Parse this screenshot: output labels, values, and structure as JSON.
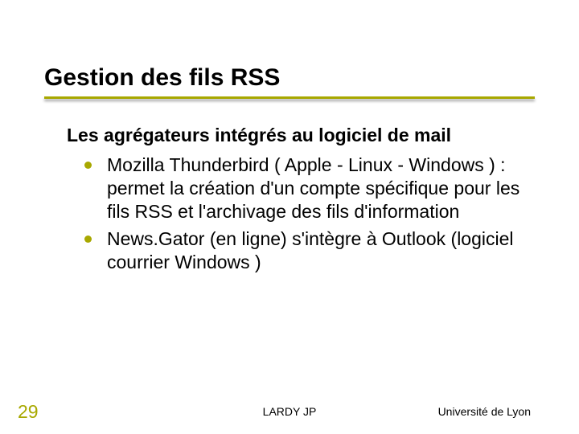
{
  "title": "Gestion des fils RSS",
  "subheading": "Les agrégateurs intégrés au logiciel de mail",
  "bullets": [
    "Mozilla Thunderbird ( Apple - Linux - Windows ) : permet la création d'un compte spécifique pour les fils RSS et l'archivage des fils d'information",
    "News.Gator (en ligne) s'intègre à  Outlook (logiciel courrier Windows )"
  ],
  "footer": {
    "page": "29",
    "center": "LARDY JP",
    "right": "Université de Lyon"
  }
}
